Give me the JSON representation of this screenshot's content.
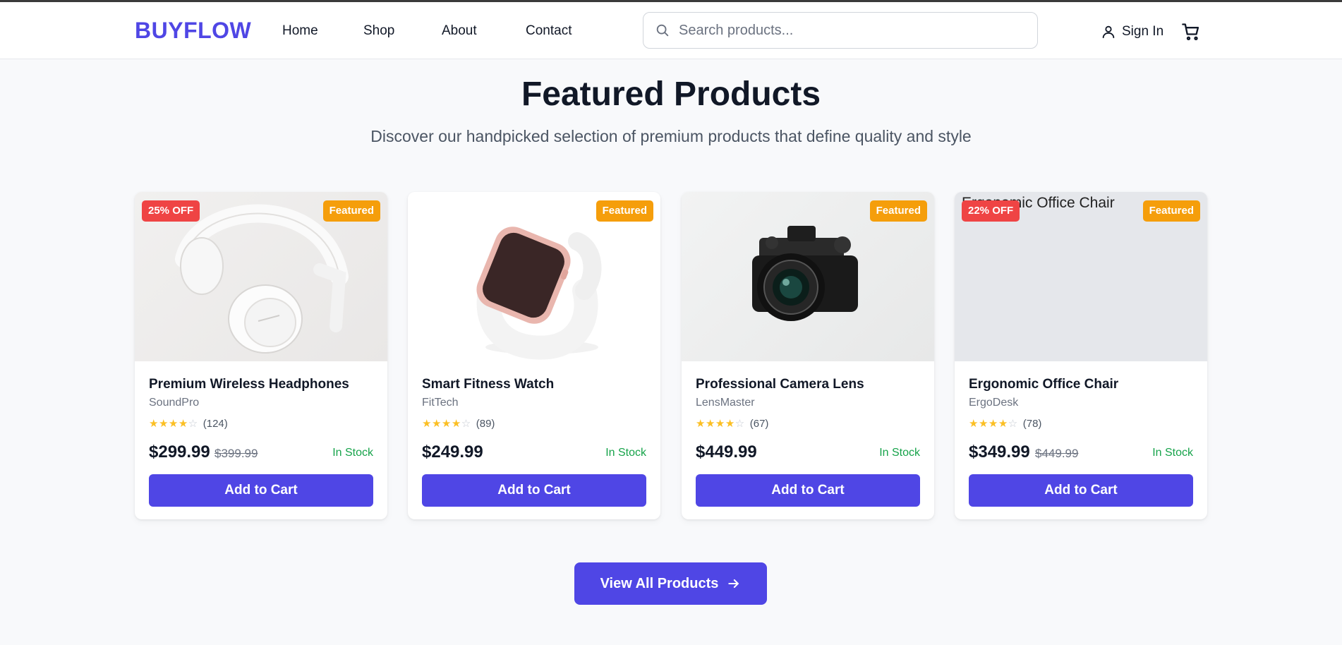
{
  "brand": {
    "logo": "BUYFLOW",
    "accent": "#4f46e5"
  },
  "nav": {
    "links": [
      "Home",
      "Shop",
      "About",
      "Contact"
    ],
    "search_placeholder": "Search products...",
    "sign_in": "Sign In"
  },
  "hero": {
    "title": "Featured Products",
    "subtitle": "Discover our handpicked selection of premium products that define quality and style"
  },
  "products": [
    {
      "name": "Premium Wireless Headphones",
      "brand": "SoundPro",
      "rating": 4,
      "reviews": "(124)",
      "price": "$299.99",
      "old_price": "$399.99",
      "discount": "25% OFF",
      "featured": "Featured",
      "stock": "In Stock",
      "cta": "Add to Cart"
    },
    {
      "name": "Smart Fitness Watch",
      "brand": "FitTech",
      "rating": 4,
      "reviews": "(89)",
      "price": "$249.99",
      "featured": "Featured",
      "stock": "In Stock",
      "cta": "Add to Cart"
    },
    {
      "name": "Professional Camera Lens",
      "brand": "LensMaster",
      "rating": 4,
      "reviews": "(67)",
      "price": "$449.99",
      "featured": "Featured",
      "stock": "In Stock",
      "cta": "Add to Cart"
    },
    {
      "name": "Ergonomic Office Chair",
      "brand": "ErgoDesk",
      "rating": 4,
      "reviews": "(78)",
      "price": "$349.99",
      "old_price": "$449.99",
      "discount": "22% OFF",
      "featured": "Featured",
      "stock": "In Stock",
      "cta": "Add to Cart",
      "image_alt": "Ergonomic Office Chair"
    }
  ],
  "view_all": "View All Products",
  "colors": {
    "discount": "#ef4444",
    "featured": "#f59e0b",
    "in_stock": "#16a34a",
    "star": "#fbbf24"
  }
}
